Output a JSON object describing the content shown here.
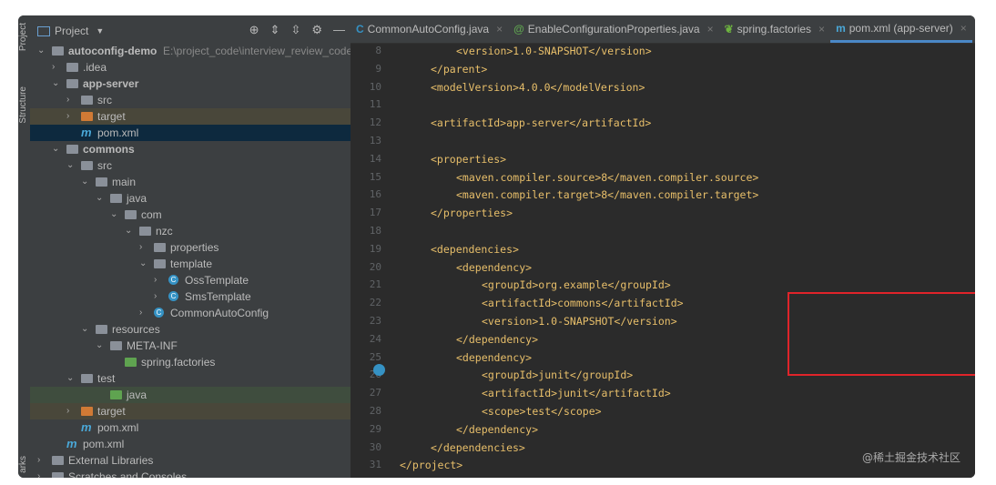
{
  "sidebar_strip": {
    "project": "Project",
    "structure": "Structure",
    "bookmarks": "arks"
  },
  "project_panel": {
    "title": "Project",
    "root_path": "E:\\project_code\\interview_review_code\\au",
    "rows": [
      {
        "d": 0,
        "a": "v",
        "i": "module",
        "t": "autoconfig-demo",
        "b": true,
        "path": true
      },
      {
        "d": 1,
        "a": ">",
        "i": "fold",
        "t": ".idea"
      },
      {
        "d": 1,
        "a": "v",
        "i": "module",
        "t": "app-server",
        "b": true
      },
      {
        "d": 2,
        "a": ">",
        "i": "fold",
        "t": "src"
      },
      {
        "d": 2,
        "a": ">",
        "i": "orange",
        "t": "target",
        "h": "ex"
      },
      {
        "d": 2,
        "a": "",
        "i": "mvn",
        "t": "pom.xml",
        "h": "sel"
      },
      {
        "d": 1,
        "a": "v",
        "i": "module",
        "t": "commons",
        "b": true
      },
      {
        "d": 2,
        "a": "v",
        "i": "fold",
        "t": "src"
      },
      {
        "d": 3,
        "a": "v",
        "i": "fold",
        "t": "main"
      },
      {
        "d": 4,
        "a": "v",
        "i": "fold",
        "t": "java"
      },
      {
        "d": 5,
        "a": "v",
        "i": "fold",
        "t": "com"
      },
      {
        "d": 6,
        "a": "v",
        "i": "fold",
        "t": "nzc"
      },
      {
        "d": 7,
        "a": ">",
        "i": "fold",
        "t": "properties"
      },
      {
        "d": 7,
        "a": "v",
        "i": "fold",
        "t": "template"
      },
      {
        "d": 8,
        "a": ">",
        "i": "cls",
        "t": "OssTemplate"
      },
      {
        "d": 8,
        "a": ">",
        "i": "cls",
        "t": "SmsTemplate"
      },
      {
        "d": 7,
        "a": ">",
        "i": "cls",
        "t": "CommonAutoConfig"
      },
      {
        "d": 3,
        "a": "v",
        "i": "fold",
        "t": "resources"
      },
      {
        "d": 4,
        "a": "v",
        "i": "fold",
        "t": "META-INF"
      },
      {
        "d": 5,
        "a": "",
        "i": "green",
        "t": "spring.factories"
      },
      {
        "d": 2,
        "a": "v",
        "i": "fold",
        "t": "test"
      },
      {
        "d": 4,
        "a": "",
        "i": "green",
        "t": "java",
        "h": "ts"
      },
      {
        "d": 2,
        "a": ">",
        "i": "orange",
        "t": "target",
        "h": "ex"
      },
      {
        "d": 2,
        "a": "",
        "i": "mvn",
        "t": "pom.xml"
      },
      {
        "d": 1,
        "a": "",
        "i": "mvn",
        "t": "pom.xml"
      },
      {
        "d": 0,
        "a": ">",
        "i": "lib",
        "t": "External Libraries"
      },
      {
        "d": 0,
        "a": ">",
        "i": "lib",
        "t": "Scratches and Consoles"
      }
    ]
  },
  "tabs": [
    {
      "label": "CommonAutoConfig.java",
      "icon": "class-icon"
    },
    {
      "label": "EnableConfigurationProperties.java",
      "icon": "annotation-icon"
    },
    {
      "label": "spring.factories",
      "icon": "spring-icon"
    },
    {
      "label": "pom.xml (app-server)",
      "icon": "maven-icon",
      "active": true
    }
  ],
  "editor": {
    "lines": [
      {
        "n": "8",
        "ind": 2,
        "c": "<version>1.0-SNAPSHOT</version>"
      },
      {
        "n": "9",
        "ind": 1,
        "c": "</parent>"
      },
      {
        "n": "10",
        "ind": 1,
        "c": "<modelVersion>4.0.0</modelVersion>"
      },
      {
        "n": "11",
        "ind": 1,
        "c": ""
      },
      {
        "n": "12",
        "ind": 1,
        "c": "<artifactId>app-server</artifactId>"
      },
      {
        "n": "13",
        "ind": 1,
        "c": ""
      },
      {
        "n": "14",
        "ind": 1,
        "c": "<properties>"
      },
      {
        "n": "15",
        "ind": 2,
        "c": "<maven.compiler.source>8</maven.compiler.source>"
      },
      {
        "n": "16",
        "ind": 2,
        "c": "<maven.compiler.target>8</maven.compiler.target>"
      },
      {
        "n": "17",
        "ind": 1,
        "c": "</properties>"
      },
      {
        "n": "18",
        "ind": 1,
        "c": ""
      },
      {
        "n": "19",
        "ind": 1,
        "c": "<dependencies>"
      },
      {
        "n": "20",
        "ind": 2,
        "c": "<dependency>"
      },
      {
        "n": "21",
        "ind": 3,
        "c": "<groupId>org.example</groupId>"
      },
      {
        "n": "22",
        "ind": 3,
        "c": "<artifactId>commons</artifactId>"
      },
      {
        "n": "23",
        "ind": 3,
        "c": "<version>1.0-SNAPSHOT</version>"
      },
      {
        "n": "24",
        "ind": 2,
        "c": "</dependency>"
      },
      {
        "n": "25",
        "ind": 2,
        "c": "<dependency>"
      },
      {
        "n": "26",
        "ind": 3,
        "c": "<groupId>junit</groupId>"
      },
      {
        "n": "27",
        "ind": 3,
        "c": "<artifactId>junit</artifactId>"
      },
      {
        "n": "28",
        "ind": 3,
        "c": "<scope>test</scope>"
      },
      {
        "n": "29",
        "ind": 2,
        "c": "</dependency>"
      },
      {
        "n": "30",
        "ind": 1,
        "c": "</dependencies>"
      },
      {
        "n": "31",
        "ind": 0,
        "c": "</project>"
      }
    ]
  },
  "watermark": "@稀土掘金技术社区"
}
